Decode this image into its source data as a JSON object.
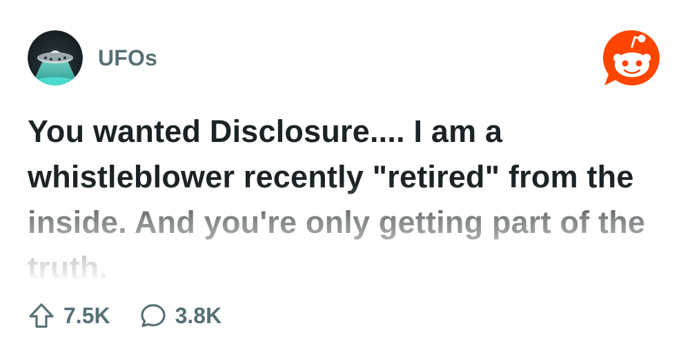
{
  "community": {
    "name": "UFOs",
    "avatar_icon": "ufo-icon"
  },
  "brand": {
    "logo_icon": "reddit-logo-icon",
    "color": "#ff4500"
  },
  "post": {
    "title": "You wanted Disclosure.... I am a whistleblower recently \"retired\" from the inside. And you're only getting part of the truth."
  },
  "stats": {
    "upvotes": "7.5K",
    "upvote_icon": "upvote-arrow-icon",
    "comments": "3.8K",
    "comment_icon": "comment-bubble-icon"
  },
  "colors": {
    "title": "#1c2326",
    "meta": "#576f76",
    "avatar_dark": "#1d2a30",
    "avatar_glow": "#3fd1c6"
  }
}
